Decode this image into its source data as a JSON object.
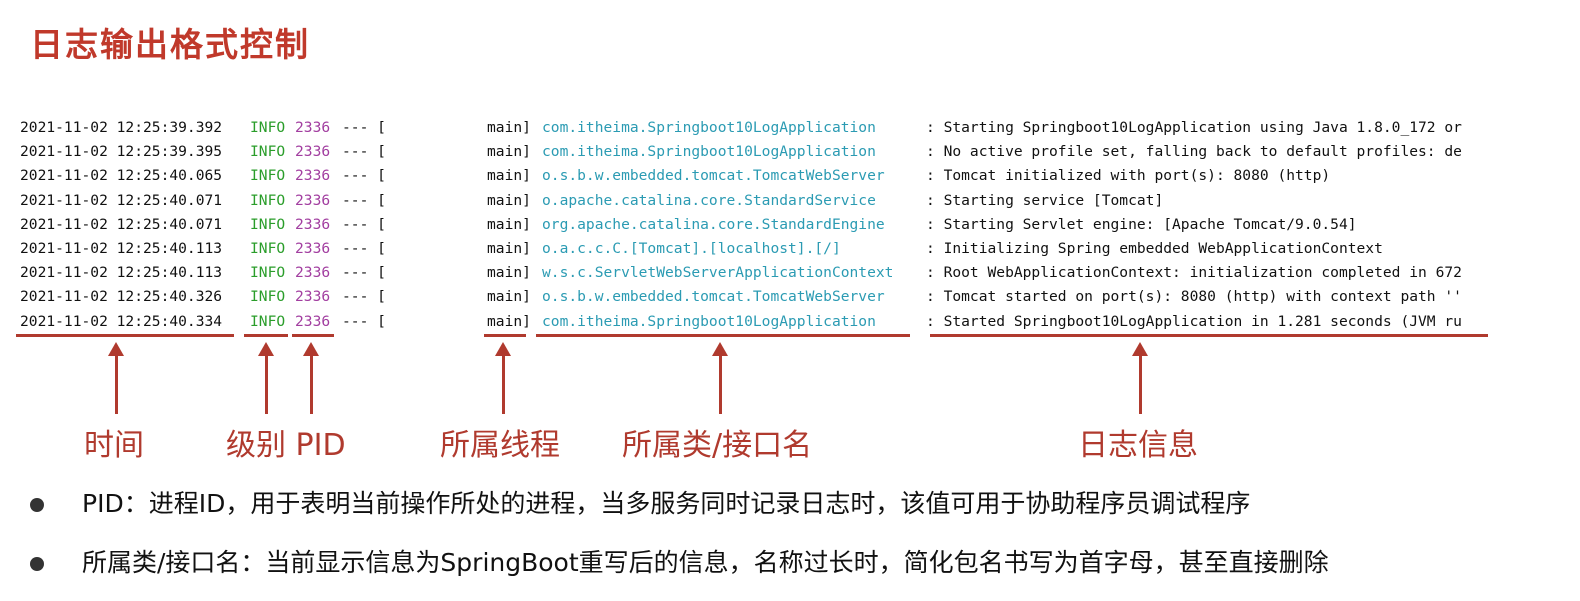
{
  "title": "日志输出格式控制",
  "log_rows": [
    {
      "time": "2021-11-02 12:25:39.392",
      "level": "INFO",
      "pid": "2336",
      "sep": "--- [",
      "thread": "main]",
      "logger": "com.itheima.Springboot10LogApplication",
      "message": ": Starting Springboot10LogApplication using Java 1.8.0_172 or"
    },
    {
      "time": "2021-11-02 12:25:39.395",
      "level": "INFO",
      "pid": "2336",
      "sep": "--- [",
      "thread": "main]",
      "logger": "com.itheima.Springboot10LogApplication",
      "message": ": No active profile set, falling back to default profiles: de"
    },
    {
      "time": "2021-11-02 12:25:40.065",
      "level": "INFO",
      "pid": "2336",
      "sep": "--- [",
      "thread": "main]",
      "logger": "o.s.b.w.embedded.tomcat.TomcatWebServer",
      "message": ": Tomcat initialized with port(s): 8080 (http)"
    },
    {
      "time": "2021-11-02 12:25:40.071",
      "level": "INFO",
      "pid": "2336",
      "sep": "--- [",
      "thread": "main]",
      "logger": "o.apache.catalina.core.StandardService",
      "message": ": Starting service [Tomcat]"
    },
    {
      "time": "2021-11-02 12:25:40.071",
      "level": "INFO",
      "pid": "2336",
      "sep": "--- [",
      "thread": "main]",
      "logger": "org.apache.catalina.core.StandardEngine",
      "message": ": Starting Servlet engine: [Apache Tomcat/9.0.54]"
    },
    {
      "time": "2021-11-02 12:25:40.113",
      "level": "INFO",
      "pid": "2336",
      "sep": "--- [",
      "thread": "main]",
      "logger": "o.a.c.c.C.[Tomcat].[localhost].[/]",
      "message": ": Initializing Spring embedded WebApplicationContext"
    },
    {
      "time": "2021-11-02 12:25:40.113",
      "level": "INFO",
      "pid": "2336",
      "sep": "--- [",
      "thread": "main]",
      "logger": "w.s.c.ServletWebServerApplicationContext",
      "message": ": Root WebApplicationContext: initialization completed in 672"
    },
    {
      "time": "2021-11-02 12:25:40.326",
      "level": "INFO",
      "pid": "2336",
      "sep": "--- [",
      "thread": "main]",
      "logger": "o.s.b.w.embedded.tomcat.TomcatWebServer",
      "message": ": Tomcat started on port(s): 8080 (http) with context path ''"
    },
    {
      "time": "2021-11-02 12:25:40.334",
      "level": "INFO",
      "pid": "2336",
      "sep": "--- [",
      "thread": "main]",
      "logger": "com.itheima.Springboot10LogApplication",
      "message": ": Started Springboot10LogApplication in 1.281 seconds (JVM ru"
    }
  ],
  "labels": {
    "time": "时间",
    "level_pid": "级别 PID",
    "thread": "所属线程",
    "logger": "所属类/接口名",
    "message": "日志信息"
  },
  "bullets": [
    "PID：进程ID，用于表明当前操作所处的进程，当多服务同时记录日志时，该值可用于协助程序员调试程序",
    "所属类/接口名：当前显示信息为SpringBoot重写后的信息，名称过长时，简化包名书写为首字母，甚至直接删除"
  ],
  "colors": {
    "title": "#c0392b",
    "annotation": "#b03a2e",
    "level": "#2a9d2a",
    "pid": "#a23ea0",
    "logger": "#2b9bb3"
  }
}
